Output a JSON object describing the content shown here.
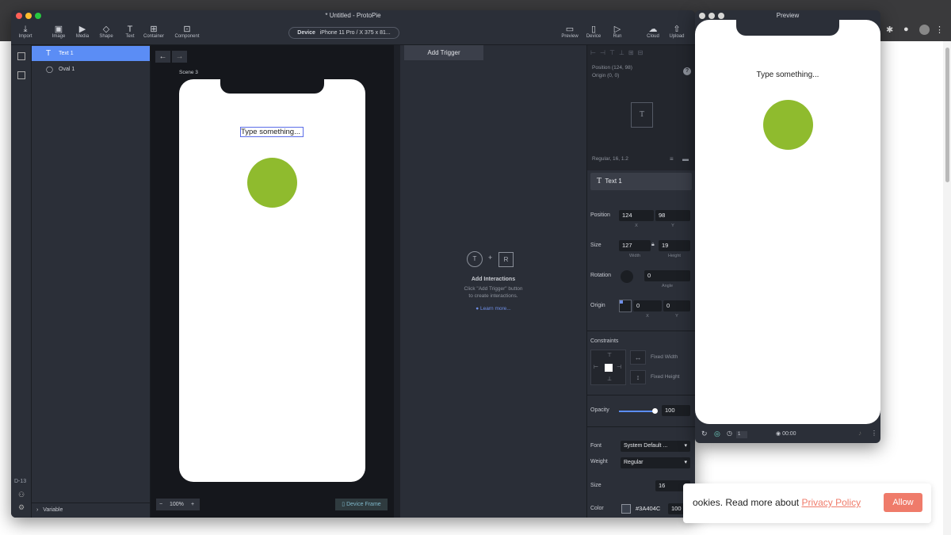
{
  "app": {
    "title": "* Untitled - ProtoPie",
    "toolbar": [
      {
        "label": "Import",
        "icon": "import-icon"
      },
      {
        "label": "Image",
        "icon": "image-icon"
      },
      {
        "label": "Media",
        "icon": "media-icon"
      },
      {
        "label": "Shape",
        "icon": "shape-icon"
      },
      {
        "label": "Text",
        "icon": "text-icon"
      },
      {
        "label": "Container",
        "icon": "container-icon"
      },
      {
        "label": "Component",
        "icon": "component-icon"
      }
    ],
    "device": {
      "label": "Device",
      "value": "iPhone 11 Pro / X  375 x 81..."
    },
    "right_tools": [
      {
        "label": "Preview",
        "icon": "preview-icon"
      },
      {
        "label": "Device",
        "icon": "device-icon"
      },
      {
        "label": "Run",
        "icon": "run-icon"
      },
      {
        "label": "Cloud",
        "icon": "cloud-icon"
      },
      {
        "label": "Upload",
        "icon": "upload-icon"
      }
    ]
  },
  "layers": {
    "items": [
      {
        "label": "Text 1",
        "glyph": "T"
      },
      {
        "label": "Oval 1",
        "glyph": "◯"
      }
    ],
    "variable_label": "Variable",
    "version": "D-13"
  },
  "canvas": {
    "scene": "Scene 3",
    "text": "Type something...",
    "zoom": "100%",
    "device_frame": "Device Frame"
  },
  "interactions": {
    "add_trigger": "Add Trigger",
    "heading": "Add Interactions",
    "line1": "Click \"Add Trigger\" button",
    "line2": "to create interactions.",
    "learn_more": "Learn more..."
  },
  "props": {
    "position_info": "Position   (124, 98)",
    "origin_info": "Origin      (0, 0)",
    "font_info": "Regular, 16, 1.2",
    "layer_name": "Text 1",
    "position": {
      "label": "Position",
      "x": "124",
      "y": "98",
      "x_label": "X",
      "y_label": "Y"
    },
    "size": {
      "label": "Size",
      "w": "127",
      "h": "19",
      "w_label": "Width",
      "h_label": "Height"
    },
    "rotation": {
      "label": "Rotation",
      "value": "0",
      "sub": "Angle"
    },
    "origin": {
      "label": "Origin",
      "x": "0",
      "y": "0",
      "x_label": "X",
      "y_label": "Y"
    },
    "constraints": {
      "label": "Constraints",
      "fixed_width": "Fixed Width",
      "fixed_height": "Fixed Height"
    },
    "opacity": {
      "label": "Opacity",
      "value": "100",
      "level": 1.0
    },
    "font": {
      "label": "Font",
      "value": "System Default ..."
    },
    "weight": {
      "label": "Weight",
      "value": "Regular"
    },
    "fsize": {
      "label": "Size",
      "value": "16"
    },
    "color": {
      "label": "Color",
      "hex": "#3A404C",
      "fill": "100",
      "hex_label": "HEX",
      "fill_label": "Fill"
    }
  },
  "preview": {
    "title": "Preview",
    "text": "Type something...",
    "time": "00:00",
    "counter": "1"
  },
  "cookie": {
    "text": "ookies. Read more about",
    "link": "Privacy Policy",
    "button": "Allow"
  },
  "colors": {
    "accent": "#5b8df5",
    "oval": "#8fbb2e",
    "allow": "#ef7b6a"
  }
}
